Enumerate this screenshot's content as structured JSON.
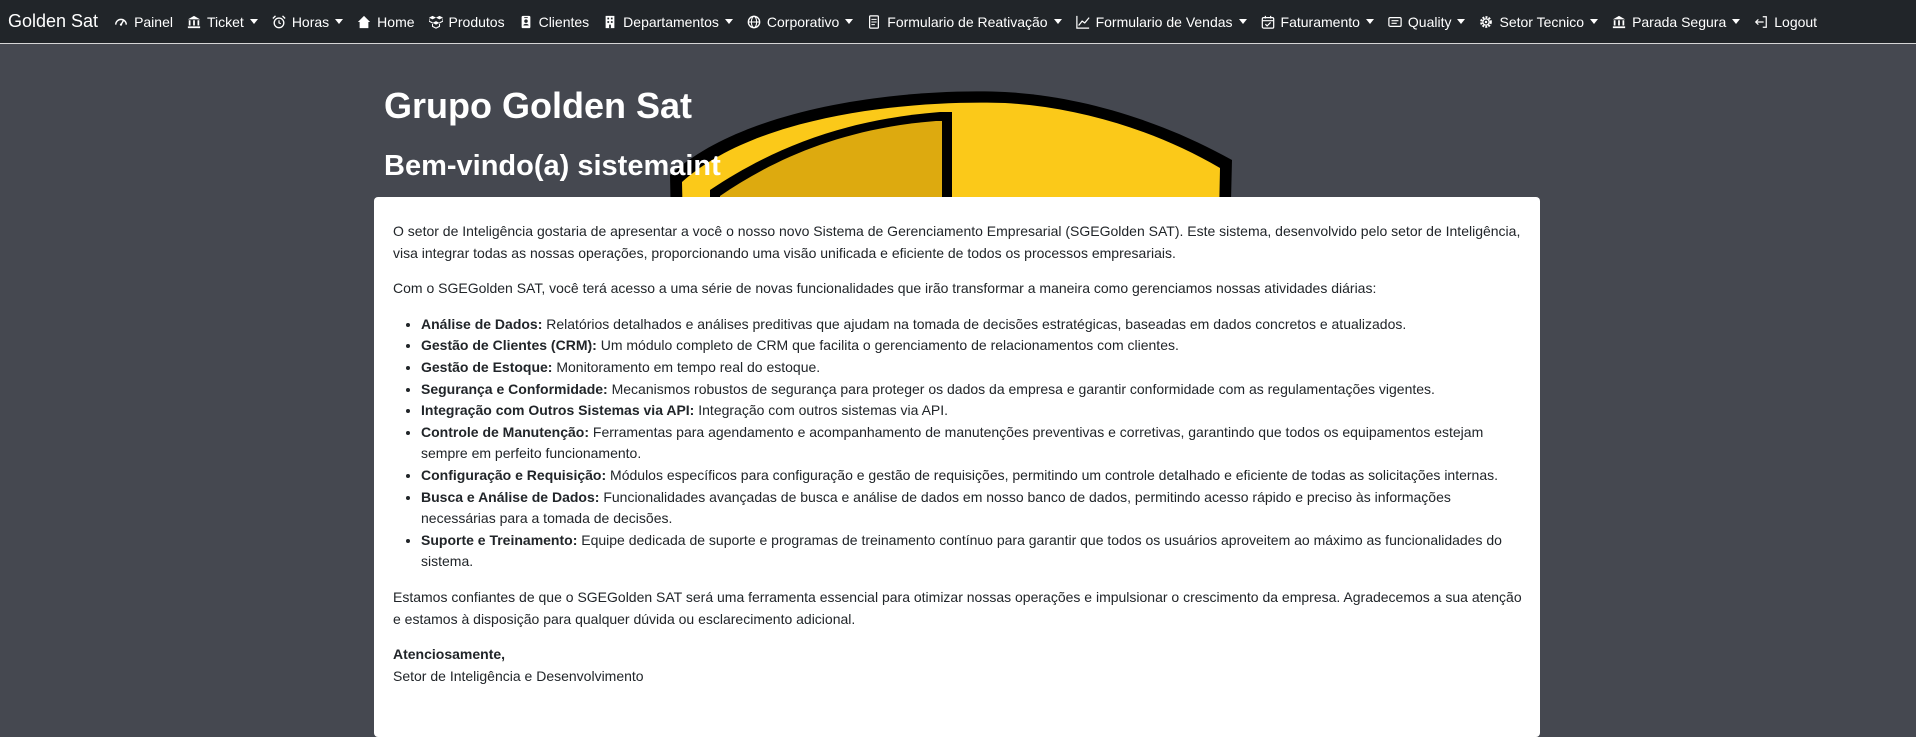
{
  "navbar": {
    "brand": "Golden Sat",
    "items": [
      {
        "label": "Painel",
        "icon": "speedometer-icon",
        "dropdown": false
      },
      {
        "label": "Ticket",
        "icon": "bank-icon",
        "dropdown": true
      },
      {
        "label": "Horas",
        "icon": "alarm-icon",
        "dropdown": true
      },
      {
        "label": "Home",
        "icon": "house-icon",
        "dropdown": false
      },
      {
        "label": "Produtos",
        "icon": "boxes-icon",
        "dropdown": false
      },
      {
        "label": "Clientes",
        "icon": "person-badge-icon",
        "dropdown": false
      },
      {
        "label": "Departamentos",
        "icon": "building-icon",
        "dropdown": true
      },
      {
        "label": "Corporativo",
        "icon": "globe-icon",
        "dropdown": true
      },
      {
        "label": "Formulario de Reativação",
        "icon": "document-icon",
        "dropdown": true
      },
      {
        "label": "Formulario de Vendas",
        "icon": "chart-line-icon",
        "dropdown": true
      },
      {
        "label": "Faturamento",
        "icon": "calendar-check-icon",
        "dropdown": true
      },
      {
        "label": "Quality",
        "icon": "card-text-icon",
        "dropdown": true
      },
      {
        "label": "Setor Tecnico",
        "icon": "gear-icon",
        "dropdown": true
      },
      {
        "label": "Parada Segura",
        "icon": "bank-icon",
        "dropdown": true
      },
      {
        "label": "Logout",
        "icon": "logout-icon",
        "dropdown": false
      }
    ]
  },
  "hero": {
    "title": "Grupo Golden Sat",
    "welcome": "Bem-vindo(a) sistemaint"
  },
  "card": {
    "intro": "O setor de Inteligência gostaria de apresentar a você o nosso novo Sistema de Gerenciamento Empresarial (SGEGolden SAT). Este sistema, desenvolvido pelo setor de Inteligência, visa integrar todas as nossas operações, proporcionando uma visão unificada e eficiente de todos os processos empresariais.",
    "lead": "Com o SGEGolden SAT, você terá acesso a uma série de novas funcionalidades que irão transformar a maneira como gerenciamos nossas atividades diárias:",
    "features": [
      {
        "title": "Análise de Dados:",
        "text": " Relatórios detalhados e análises preditivas que ajudam na tomada de decisões estratégicas, baseadas em dados concretos e atualizados."
      },
      {
        "title": "Gestão de Clientes (CRM):",
        "text": " Um módulo completo de CRM que facilita o gerenciamento de relacionamentos com clientes."
      },
      {
        "title": "Gestão de Estoque:",
        "text": " Monitoramento em tempo real do estoque."
      },
      {
        "title": "Segurança e Conformidade:",
        "text": " Mecanismos robustos de segurança para proteger os dados da empresa e garantir conformidade com as regulamentações vigentes."
      },
      {
        "title": "Integração com Outros Sistemas via API:",
        "text": " Integração com outros sistemas via API."
      },
      {
        "title": "Controle de Manutenção:",
        "text": " Ferramentas para agendamento e acompanhamento de manutenções preventivas e corretivas, garantindo que todos os equipamentos estejam sempre em perfeito funcionamento."
      },
      {
        "title": "Configuração e Requisição:",
        "text": " Módulos específicos para configuração e gestão de requisições, permitindo um controle detalhado e eficiente de todas as solicitações internas."
      },
      {
        "title": "Busca e Análise de Dados:",
        "text": " Funcionalidades avançadas de busca e análise de dados em nosso banco de dados, permitindo acesso rápido e preciso às informações necessárias para a tomada de decisões."
      },
      {
        "title": "Suporte e Treinamento:",
        "text": " Equipe dedicada de suporte e programas de treinamento contínuo para garantir que todos os usuários aproveitem ao máximo as funcionalidades do sistema."
      }
    ],
    "closing": "Estamos confiantes de que o SGEGolden SAT será uma ferramenta essencial para otimizar nossas operações e impulsionar o crescimento da empresa. Agradecemos a sua atenção e estamos à disposição para qualquer dúvida ou esclarecimento adicional.",
    "signoff": "Atenciosamente,",
    "signature": "Setor de Inteligência e Desenvolvimento"
  },
  "colors": {
    "navbar_bg": "#212529",
    "page_bg": "#454850",
    "logo_yellow": "#fbc919",
    "logo_dark_yellow": "#ddaa0f",
    "card_bg": "#ffffff"
  }
}
